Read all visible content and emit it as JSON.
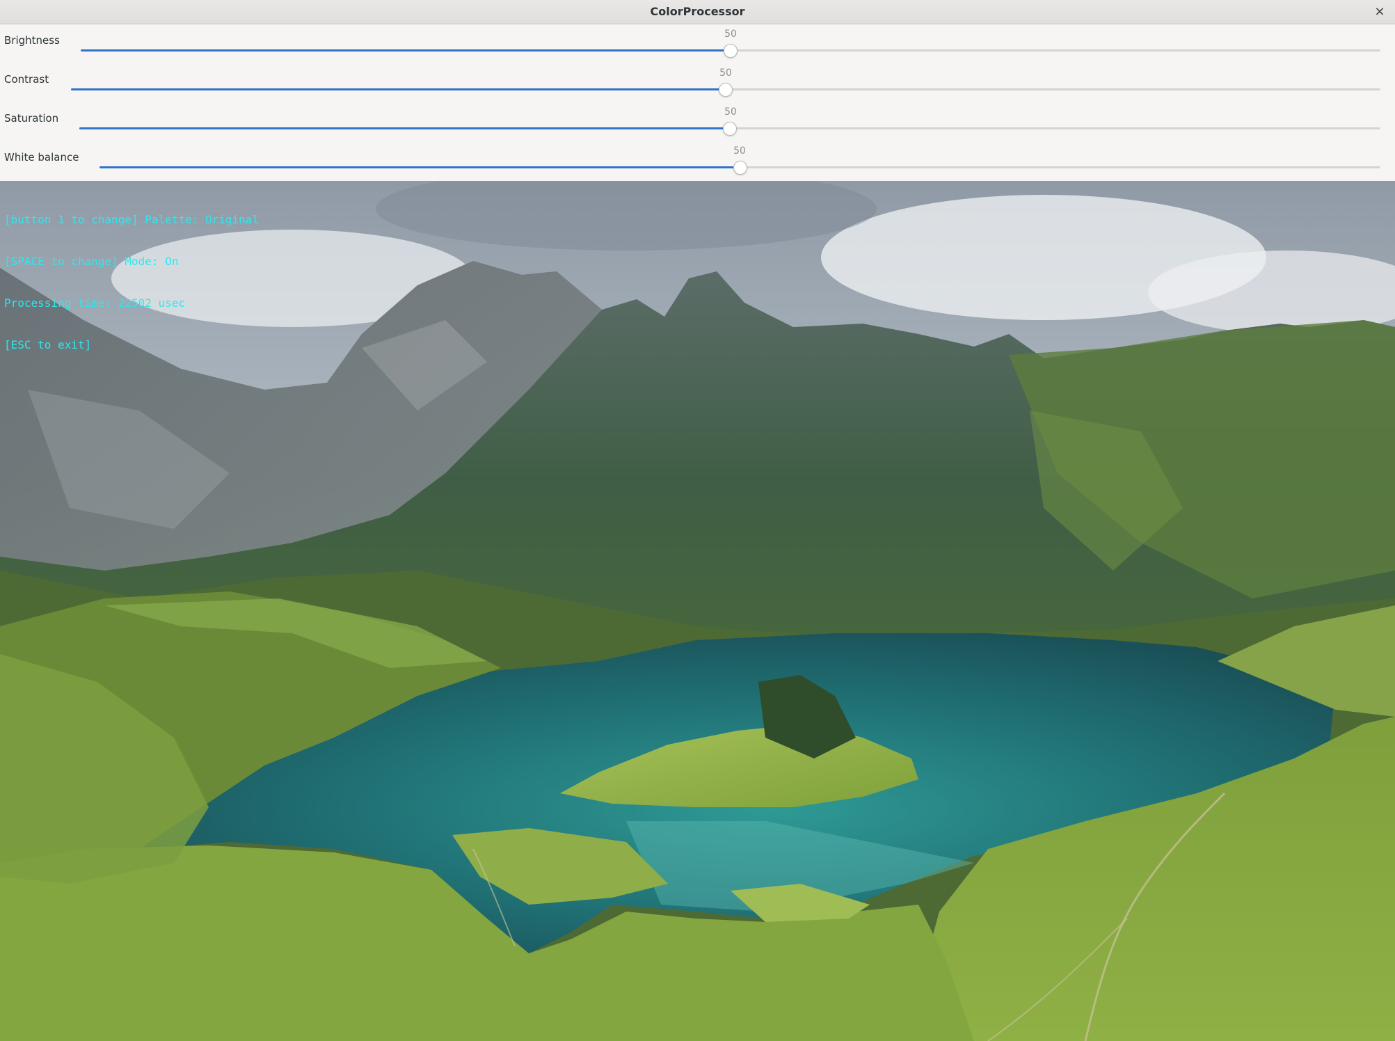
{
  "window": {
    "title": "ColorProcessor",
    "close_icon": "close-icon",
    "close_glyph": "×"
  },
  "sliders": [
    {
      "label": "Brightness",
      "value": 50,
      "min": 0,
      "max": 100
    },
    {
      "label": "Contrast",
      "value": 50,
      "min": 0,
      "max": 100
    },
    {
      "label": "Saturation",
      "value": 50,
      "min": 0,
      "max": 100
    },
    {
      "label": "White balance",
      "value": 50,
      "min": 0,
      "max": 100
    }
  ],
  "overlay": {
    "lines": [
      "[button 1 to change] Palette: Original",
      "[SPACE to change] Mode: On",
      "Processing time: 22502 usec",
      "[ESC to exit]"
    ],
    "color": "#2de8ee"
  },
  "colors": {
    "accent": "#3074c9",
    "trough": "#d6d4d1"
  }
}
